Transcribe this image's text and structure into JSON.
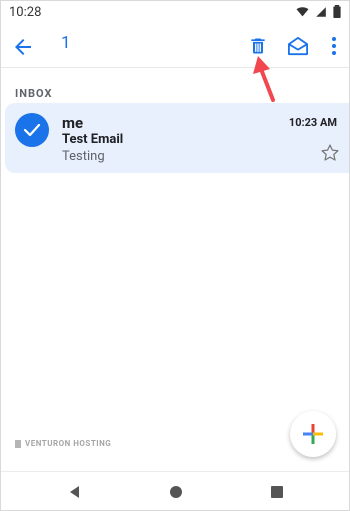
{
  "status": {
    "time": "10:28"
  },
  "toolbar": {
    "selected_count": "1",
    "icons": [
      "arrow-back-icon",
      "delete-icon",
      "mark-unread-icon",
      "more-vert-icon"
    ]
  },
  "inbox": {
    "label": "INBOX",
    "emails": [
      {
        "sender": "me",
        "subject": "Test Email",
        "snippet": "Testing",
        "time": "10:23 AM"
      }
    ]
  },
  "watermark": {
    "text": "VENTURON HOSTING"
  },
  "colors": {
    "accent": "#1a73e8",
    "selected_row": "#e8f0fe",
    "annotation_arrow": "#f0484e"
  }
}
